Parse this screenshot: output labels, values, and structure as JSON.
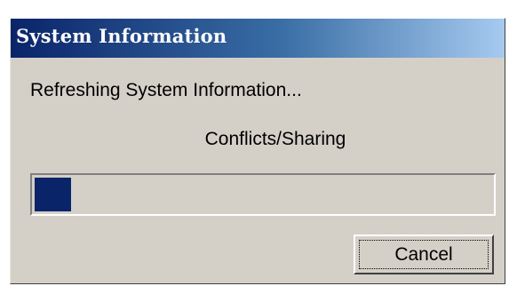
{
  "window": {
    "title": "System Information"
  },
  "status": {
    "message": "Refreshing System Information...",
    "category": "Conflicts/Sharing"
  },
  "progress": {
    "fraction": 0.08,
    "fill_color": "#0a246a"
  },
  "buttons": {
    "cancel_label": "Cancel"
  }
}
